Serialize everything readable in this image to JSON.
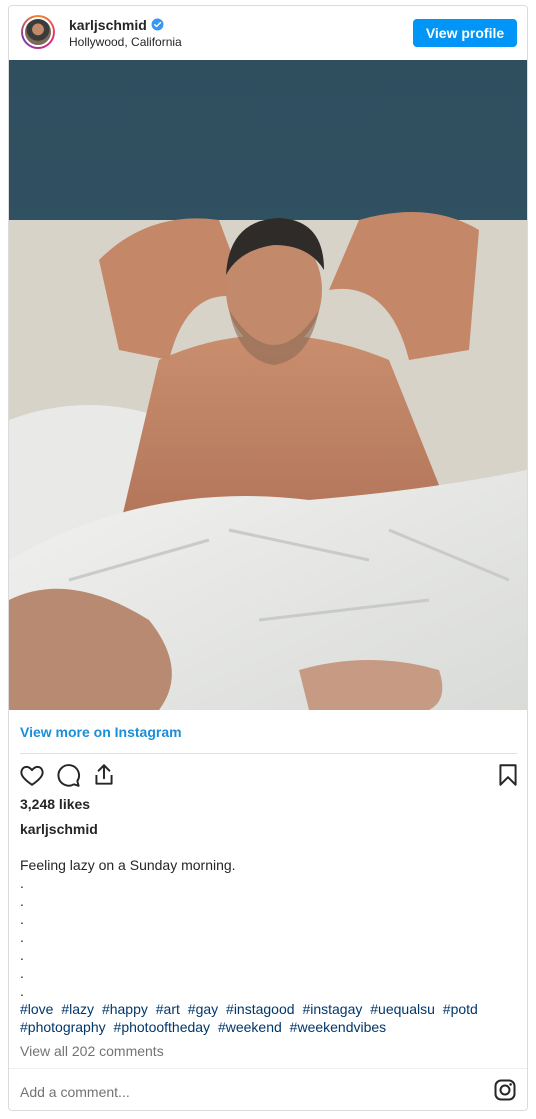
{
  "header": {
    "username": "karljschmid",
    "location": "Hollywood, California",
    "view_profile_label": "View profile",
    "verified_color": "#3897f0"
  },
  "post": {
    "view_more_label": "View more on Instagram",
    "likes": "3,248 likes",
    "caption_username": "karljschmid",
    "caption_text": "Feeling lazy on a Sunday morning.",
    "caption_dots": [
      ".",
      ".",
      ".",
      ".",
      ".",
      ".",
      "."
    ],
    "hashtags": [
      "#love",
      "#lazy",
      "#happy",
      "#art",
      "#gay",
      "#instagood",
      "#instagay",
      "#uequalsu",
      "#potd",
      "#photography",
      "#photooftheday",
      "#weekend",
      "#weekendvibes"
    ],
    "comments_link": "View all 202 comments",
    "add_comment_placeholder": "Add a comment..."
  },
  "icons": {
    "like": "heart-icon",
    "comment": "comment-icon",
    "share": "share-icon",
    "save": "bookmark-icon",
    "brand": "instagram-icon"
  },
  "colors": {
    "accent": "#0095f6",
    "link": "#1a8fd8",
    "hashtag": "#00376b",
    "muted": "#737373"
  }
}
